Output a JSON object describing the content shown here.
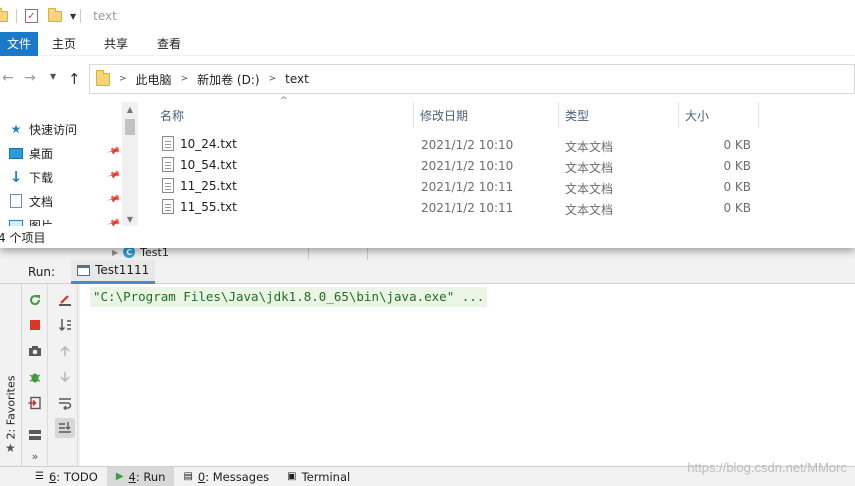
{
  "explorer": {
    "title": "text",
    "ribbon": {
      "file": "文件",
      "home": "主页",
      "share": "共享",
      "view": "查看"
    },
    "breadcrumb": [
      "此电脑",
      "新加卷 (D:)",
      "text"
    ],
    "nav_pane": {
      "items": [
        {
          "label": "快速访问",
          "icon": "star-icon",
          "pinned": false
        },
        {
          "label": "桌面",
          "icon": "desktop-icon",
          "pinned": true
        },
        {
          "label": "下载",
          "icon": "download-icon",
          "pinned": true
        },
        {
          "label": "文档",
          "icon": "document-icon",
          "pinned": true
        },
        {
          "label": "图片",
          "icon": "pictures-icon",
          "pinned": true
        }
      ]
    },
    "columns": {
      "name": "名称",
      "date": "修改日期",
      "type": "类型",
      "size": "大小"
    },
    "files": [
      {
        "name": "10_24.txt",
        "date": "2021/1/2 10:10",
        "type": "文本文档",
        "size": "0 KB"
      },
      {
        "name": "10_54.txt",
        "date": "2021/1/2 10:10",
        "type": "文本文档",
        "size": "0 KB"
      },
      {
        "name": "11_25.txt",
        "date": "2021/1/2 10:11",
        "type": "文本文档",
        "size": "0 KB"
      },
      {
        "name": "11_55.txt",
        "date": "2021/1/2 10:11",
        "type": "文本文档",
        "size": "0 KB"
      }
    ],
    "status": "4 个项目",
    "accent_color": "#1979ca"
  },
  "ide": {
    "behind_tree_item": "Test1",
    "behind_class_badge": "C",
    "run_label": "Run:",
    "run_tab": "Test1111",
    "console_line": "\"C:\\Program Files\\Java\\jdk1.8.0_65\\bin\\java.exe\" ...",
    "favorites_label": "2: Favorites",
    "tool_buttons_left": [
      "rerun-icon",
      "stop-icon",
      "camera-icon",
      "bug-icon",
      "exit-icon",
      "layout-icon",
      "more-icon"
    ],
    "tool_buttons_right": [
      "clear-icon",
      "sort-icon",
      "up-arrow-icon",
      "down-arrow-icon",
      "soft-wrap-icon",
      "scroll-to-end-icon"
    ],
    "more_glyph": "»",
    "status_bar": {
      "todo_num": "6",
      "todo": ": TODO",
      "run_num": "4",
      "run": ": Run",
      "messages_num": "0",
      "messages": ": Messages",
      "terminal": "Terminal"
    },
    "watermark": "https://blog.csdn.net/MMorc",
    "console_text_color": "#1f6f1f"
  }
}
